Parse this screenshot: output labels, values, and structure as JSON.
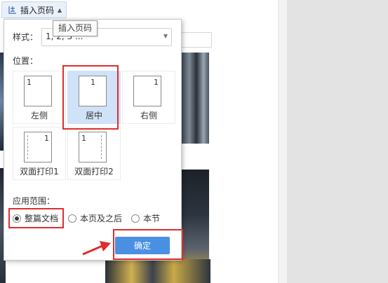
{
  "toolbar": {
    "insert_page_number_label": "插入页码",
    "dropdown_icon": "caret-down-icon",
    "tooltip": "插入页码"
  },
  "panel": {
    "style_label": "样式：",
    "style_value": "1, 2, 3 ...",
    "position_label": "位置：",
    "positions": [
      {
        "label": "左侧",
        "number": "1",
        "selected": false
      },
      {
        "label": "居中",
        "number": "1",
        "selected": true
      },
      {
        "label": "右侧",
        "number": "1",
        "selected": false
      },
      {
        "label": "双面打印1",
        "number": "1",
        "selected": false
      },
      {
        "label": "双面打印2",
        "number": "1",
        "selected": false
      }
    ],
    "scope_label": "应用范围：",
    "scope_options": [
      {
        "label": "整篇文档",
        "selected": true
      },
      {
        "label": "本页及之后",
        "selected": false
      },
      {
        "label": "本节",
        "selected": false
      }
    ],
    "confirm_label": "确定"
  },
  "colors": {
    "accent": "#4a90e2",
    "selected_card": "#cfe2f8",
    "highlight": "#e02d2d"
  }
}
